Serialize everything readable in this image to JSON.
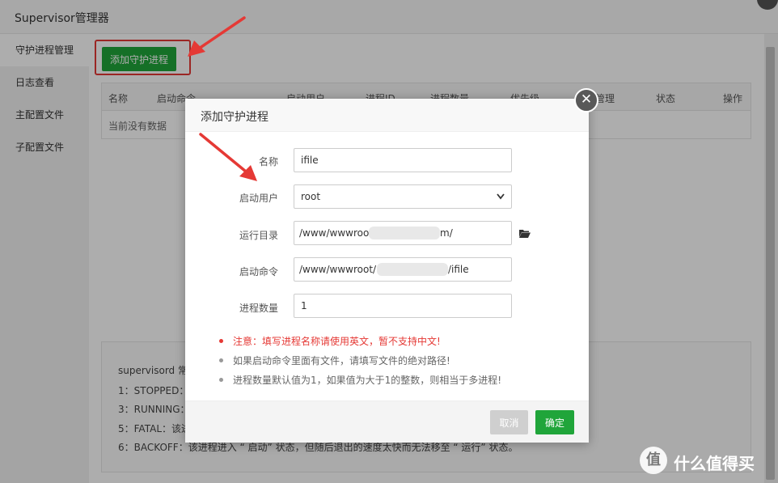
{
  "window": {
    "title": "Supervisor管理器"
  },
  "sidebar": {
    "items": [
      {
        "label": "守护进程管理"
      },
      {
        "label": "日志查看"
      },
      {
        "label": "主配置文件"
      },
      {
        "label": "子配置文件"
      }
    ]
  },
  "toolbar": {
    "add_label": "添加守护进程"
  },
  "table": {
    "columns": [
      "名称",
      "启动命令",
      "启动用户",
      "进程ID",
      "进程数量",
      "优先级",
      "管理",
      "状态",
      "操作"
    ],
    "empty_text": "当前没有数据"
  },
  "info": {
    "lines": [
      "supervisord 常",
      "1：STOPPED：",
      "3：RUNNING：",
      "5：FATAL：该进",
      "6：BACKOFF：该进程进入 “ 启动” 状态，但随后退出的速度太快而无法移至 “ 运行” 状态。"
    ]
  },
  "modal": {
    "title": "添加守护进程",
    "fields": {
      "name": {
        "label": "名称",
        "value": "ifile"
      },
      "user": {
        "label": "启动用户",
        "value": "root"
      },
      "dir": {
        "label": "运行目录",
        "value_prefix": "/www/wwwroot",
        "value_suffix": "m/"
      },
      "cmd": {
        "label": "启动命令",
        "value_prefix": "/www/wwwroot/",
        "value_suffix": "/ifile"
      },
      "count": {
        "label": "进程数量",
        "value": "1"
      }
    },
    "tips": [
      "注意：填写进程名称请使用英文，暂不支持中文!",
      "如果启动命令里面有文件，请填写文件的绝对路径!",
      "进程数量默认值为1，如果值为大于1的整数，则相当于多进程!"
    ],
    "cancel_label": "取消",
    "ok_label": "确定",
    "close_glyph": "✕"
  },
  "watermark": {
    "glyph": "值",
    "text": "什么值得买"
  },
  "colors": {
    "accent": "#20a53a",
    "warning": "#e53935",
    "annotation": "#e53935"
  },
  "icons": [
    "folder-open-icon",
    "chevron-down-icon",
    "close-icon"
  ]
}
